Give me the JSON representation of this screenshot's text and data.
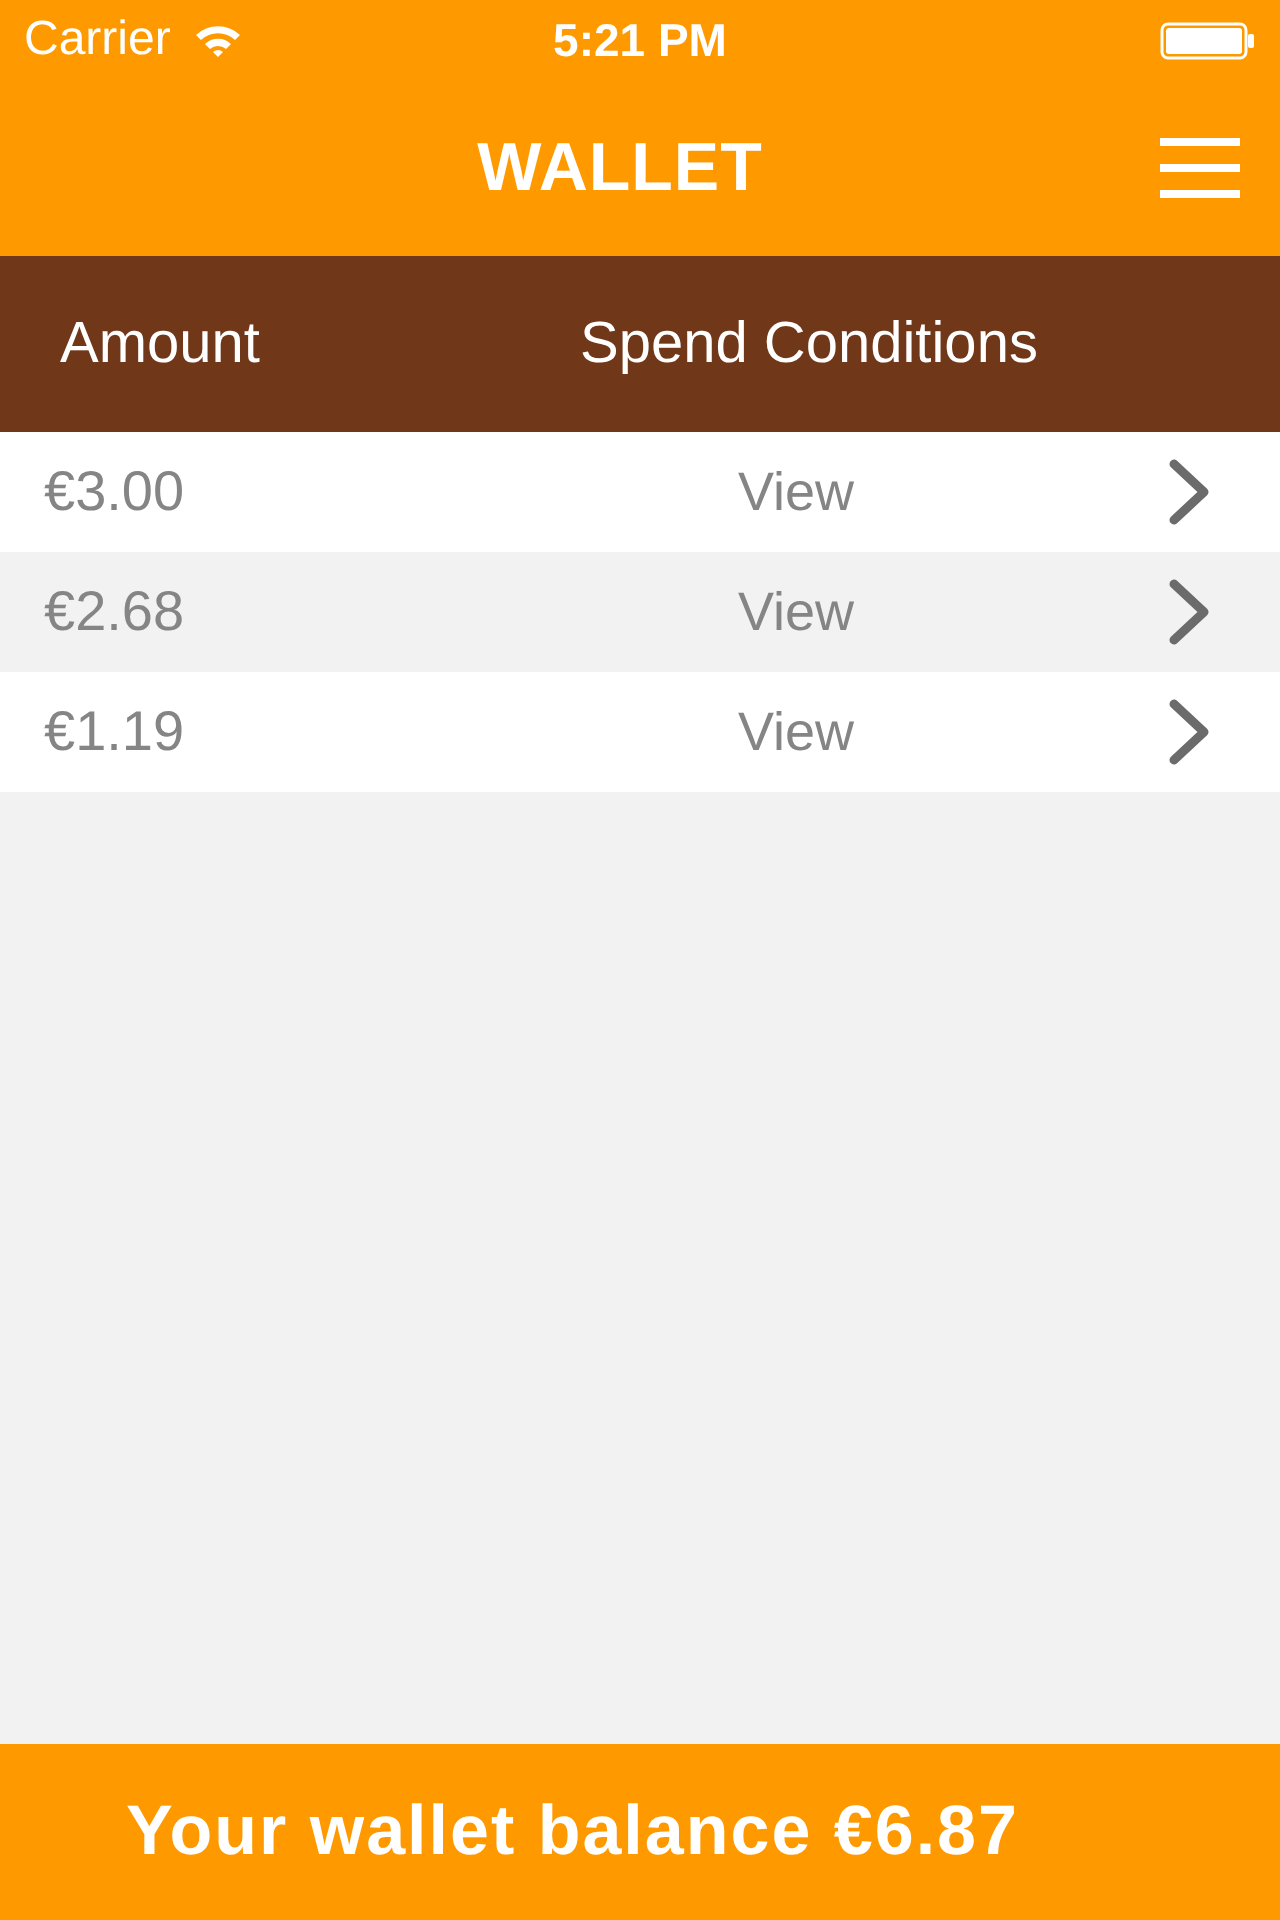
{
  "status_bar": {
    "carrier": "Carrier",
    "time": "5:21 PM"
  },
  "nav_bar": {
    "title": "WALLET"
  },
  "table": {
    "columns": [
      "Amount",
      "Spend Conditions"
    ],
    "rows": [
      {
        "amount": "€3.00",
        "conditions": "View"
      },
      {
        "amount": "€2.68",
        "conditions": "View"
      },
      {
        "amount": "€1.19",
        "conditions": "View"
      }
    ]
  },
  "footer": {
    "balance_text": "Your wallet balance €6.87"
  }
}
